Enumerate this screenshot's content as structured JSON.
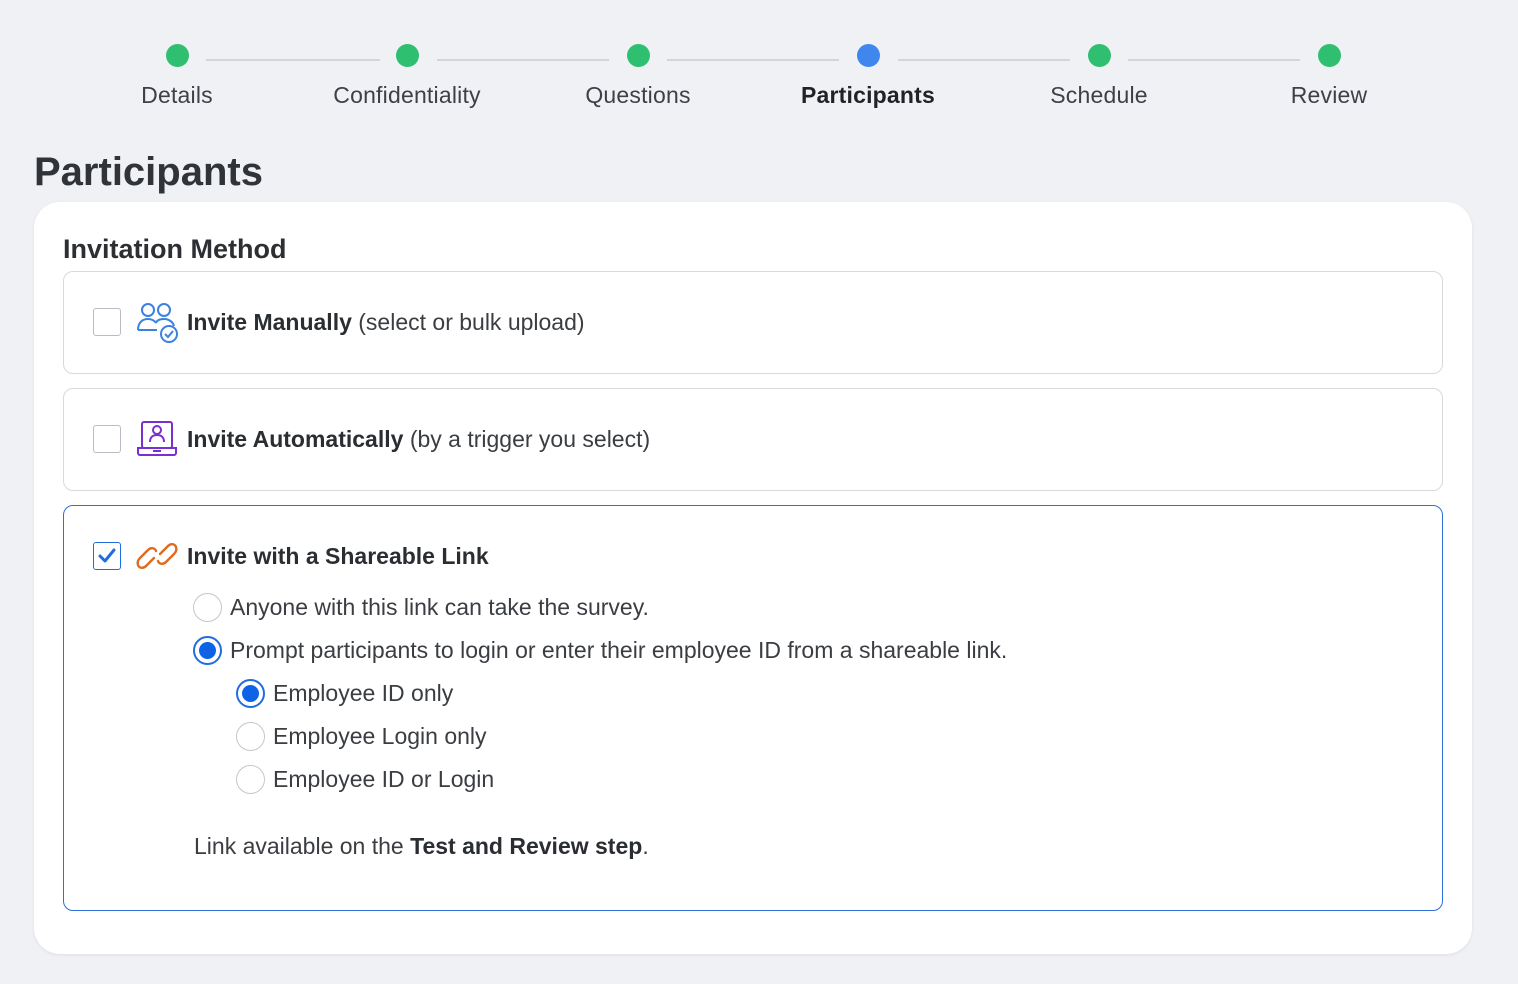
{
  "stepper": {
    "steps": [
      {
        "label": "Details",
        "state": "complete"
      },
      {
        "label": "Confidentiality",
        "state": "complete"
      },
      {
        "label": "Questions",
        "state": "complete"
      },
      {
        "label": "Participants",
        "state": "active"
      },
      {
        "label": "Schedule",
        "state": "complete"
      },
      {
        "label": "Review",
        "state": "complete"
      }
    ],
    "colors": {
      "complete": "#2fbf71",
      "active": "#3f86ee"
    }
  },
  "page": {
    "title": "Participants"
  },
  "invitation": {
    "section_title": "Invitation Method",
    "options": [
      {
        "label": "Invite Manually",
        "hint": "(select or bulk upload)",
        "checked": false,
        "icon": "people-check-icon"
      },
      {
        "label": "Invite Automatically",
        "hint": "(by a trigger you select)",
        "checked": false,
        "icon": "laptop-user-icon"
      },
      {
        "label": "Invite with a Shareable Link",
        "hint": "",
        "checked": true,
        "icon": "link-icon"
      }
    ],
    "link_modes": [
      {
        "label": "Anyone with this link can take the survey.",
        "selected": false
      },
      {
        "label": "Prompt participants to login or enter their employee ID from a shareable link.",
        "selected": true
      }
    ],
    "id_modes": [
      {
        "label": "Employee ID only",
        "selected": true
      },
      {
        "label": "Employee Login only",
        "selected": false
      },
      {
        "label": "Employee ID or Login",
        "selected": false
      }
    ],
    "note": {
      "prefix": "Link available on the ",
      "bold": "Test and Review step",
      "suffix": "."
    }
  },
  "colors": {
    "accent": "#1f6ee0",
    "selected_border": "#2f6fd6",
    "manual_icon": "#3b82e0",
    "auto_icon": "#7a2fd0",
    "link_icon": "#e06a1f"
  }
}
